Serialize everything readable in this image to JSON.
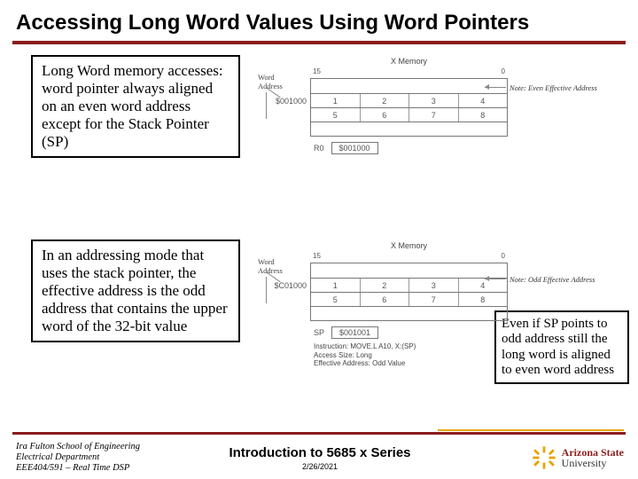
{
  "title": "Accessing Long Word Values Using Word Pointers",
  "box1_text": "Long Word memory accesses: word pointer always aligned on an even word address except for the Stack Pointer (SP)",
  "box2_text": "In an addressing mode that uses the stack pointer, the effective address is the odd address that contains the upper word of the 32-bit value",
  "box3_text": "Even if SP points to odd address still the long word is aligned to even word address",
  "diagram1": {
    "header_xmem": "X Memory",
    "bit_hi": "15",
    "bit_lo": "0",
    "word_addr_label": "Word\nAddress",
    "addr": "$001000",
    "cells": [
      "1",
      "2",
      "3",
      "4",
      "5",
      "6",
      "7",
      "8"
    ],
    "reg_name": "R0",
    "reg_val": "$001000",
    "note": "Note: Even Effective Address"
  },
  "diagram2": {
    "header_xmem": "X Memory",
    "bit_hi": "15",
    "bit_lo": "0",
    "word_addr_label": "Word\nAddress",
    "addr": "$C01000",
    "cells": [
      "1",
      "2",
      "3",
      "4",
      "5",
      "6",
      "7",
      "8"
    ],
    "reg_name": "SP",
    "reg_val": "$001001",
    "note": "Note: Odd Effective Address",
    "caption_l1": "Instruction: MOVE.L A10, X:(SP)",
    "caption_l2": "Access Size: Long",
    "caption_l3": "Effective Address: Odd Value"
  },
  "footer": {
    "line1": "Ira Fulton School of Engineering",
    "line2": "Electrical Department",
    "line3": "EEE404/591 – Real Time DSP",
    "center_title": "Introduction to 5685 x Series",
    "date": "2/26/2021",
    "asu1": "Arizona State",
    "asu2": "University"
  }
}
